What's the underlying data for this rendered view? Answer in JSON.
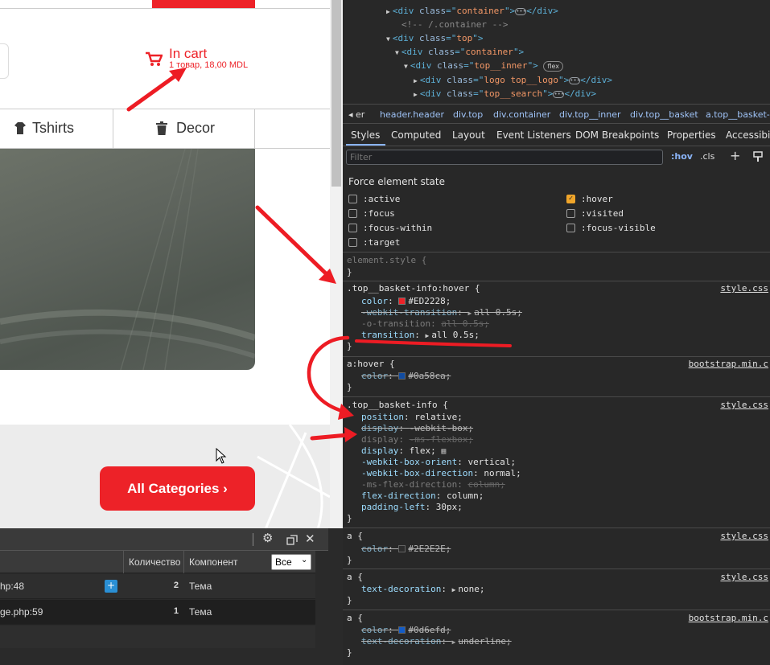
{
  "site": {
    "cart": {
      "title": "In cart",
      "subtitle": "1 товар, 18,00 MDL"
    },
    "nav": [
      {
        "icon": "tshirt-icon",
        "label": "Tshirts"
      },
      {
        "icon": "trash-can-icon",
        "label": "Decor"
      }
    ],
    "all_categories_button": "All Categories ›"
  },
  "debug_panel": {
    "columns": [
      "Количество",
      "Компонент"
    ],
    "filter_value": "Все",
    "rows": [
      {
        "file": "hp:48",
        "count": "2",
        "component": "Тема"
      },
      {
        "file": "ge.php:59",
        "count": "1",
        "component": "Тема"
      }
    ]
  },
  "devtools": {
    "dom": [
      {
        "indent": 0,
        "arrow": "▶",
        "tag": "div",
        "class": "container",
        "collapsed": true
      },
      {
        "indent": 1,
        "comment": "<!-- /.container -->"
      },
      {
        "indent": 0,
        "arrow": "▼",
        "tag": "div",
        "class": "top"
      },
      {
        "indent": 1,
        "arrow": "▼",
        "tag": "div",
        "class": "container"
      },
      {
        "indent": 2,
        "arrow": "▼",
        "tag": "div",
        "class": "top__inner",
        "badge": "flex"
      },
      {
        "indent": 3,
        "arrow": "▶",
        "tag": "div",
        "class": "logo top__logo",
        "collapsed": true
      },
      {
        "indent": 3,
        "arrow": "▶",
        "tag": "div",
        "class": "top__search",
        "collapsed": true
      }
    ],
    "breadcrumbs": [
      "◂ er",
      "header.header",
      "div.top",
      "div.container",
      "div.top__inner",
      "div.top__basket",
      "a.top__basket-i"
    ],
    "tabs": [
      "Styles",
      "Computed",
      "Layout",
      "Event Listeners",
      "DOM Breakpoints",
      "Properties",
      "Accessibili"
    ],
    "filter_placeholder": "Filter",
    "toolbar": {
      "hov": ":hov",
      "cls": ".cls",
      "add": "+"
    },
    "force_state_title": "Force element state",
    "states": [
      {
        "label": ":active",
        "checked": false
      },
      {
        "label": ":hover",
        "checked": true
      },
      {
        "label": ":focus",
        "checked": false
      },
      {
        "label": ":visited",
        "checked": false
      },
      {
        "label": ":focus-within",
        "checked": false
      },
      {
        "label": ":focus-visible",
        "checked": false
      },
      {
        "label": ":target",
        "checked": false
      }
    ],
    "rules": {
      "element_style": "element.style {",
      "hover_rule": {
        "selector": ".top__basket-info:hover {",
        "source": "style.css"
      },
      "a_hover_rule": {
        "selector": "a:hover {",
        "source": "bootstrap.min.c"
      },
      "basket_rule": {
        "selector": ".top__basket-info {",
        "source": "style.css"
      },
      "a_rule_1": {
        "selector": "a {",
        "source": "style.css"
      },
      "a_rule_2": {
        "selector": "a {",
        "source": "style.css"
      },
      "a_rule_3": {
        "selector": "a {",
        "source": "bootstrap.min.c"
      }
    },
    "props": {
      "color_hover": {
        "name": "color",
        "value": "#ED2228;",
        "swatch": "#ED2228"
      },
      "webkit_transition": {
        "name": "-webkit-transition",
        "value": "all 0.5s;"
      },
      "o_transition": {
        "name": "-o-transition",
        "value": "all 0.5s;"
      },
      "transition": {
        "name": "transition",
        "value": "all 0.5s;"
      },
      "a_hover_color": {
        "name": "color",
        "value": "#0a58ca;",
        "swatch": "#0a58ca"
      },
      "position": {
        "name": "position",
        "value": "relative;"
      },
      "display_webkit": {
        "name": "display",
        "value": "-webkit-box;"
      },
      "display_ms": {
        "name": "display",
        "value": "-ms-flexbox;"
      },
      "display_flex": {
        "name": "display",
        "value": "flex;"
      },
      "box_orient": {
        "name": "-webkit-box-orient",
        "value": "vertical;"
      },
      "box_direction": {
        "name": "-webkit-box-direction",
        "value": "normal;"
      },
      "ms_flex_direction": {
        "name": "-ms-flex-direction",
        "value": "column;"
      },
      "flex_direction": {
        "name": "flex-direction",
        "value": "column;"
      },
      "padding_left": {
        "name": "padding-left",
        "value": "30px;"
      },
      "a_color": {
        "name": "color",
        "value": "#2E2E2E;",
        "swatch": "#2E2E2E"
      },
      "text_decoration_none": {
        "name": "text-decoration",
        "value": "none;"
      },
      "a_color_bs": {
        "name": "color",
        "value": "#0d6efd;",
        "swatch": "#0d6efd"
      },
      "text_decoration_underline": {
        "name": "text-decoration",
        "value": "underline;"
      }
    }
  }
}
